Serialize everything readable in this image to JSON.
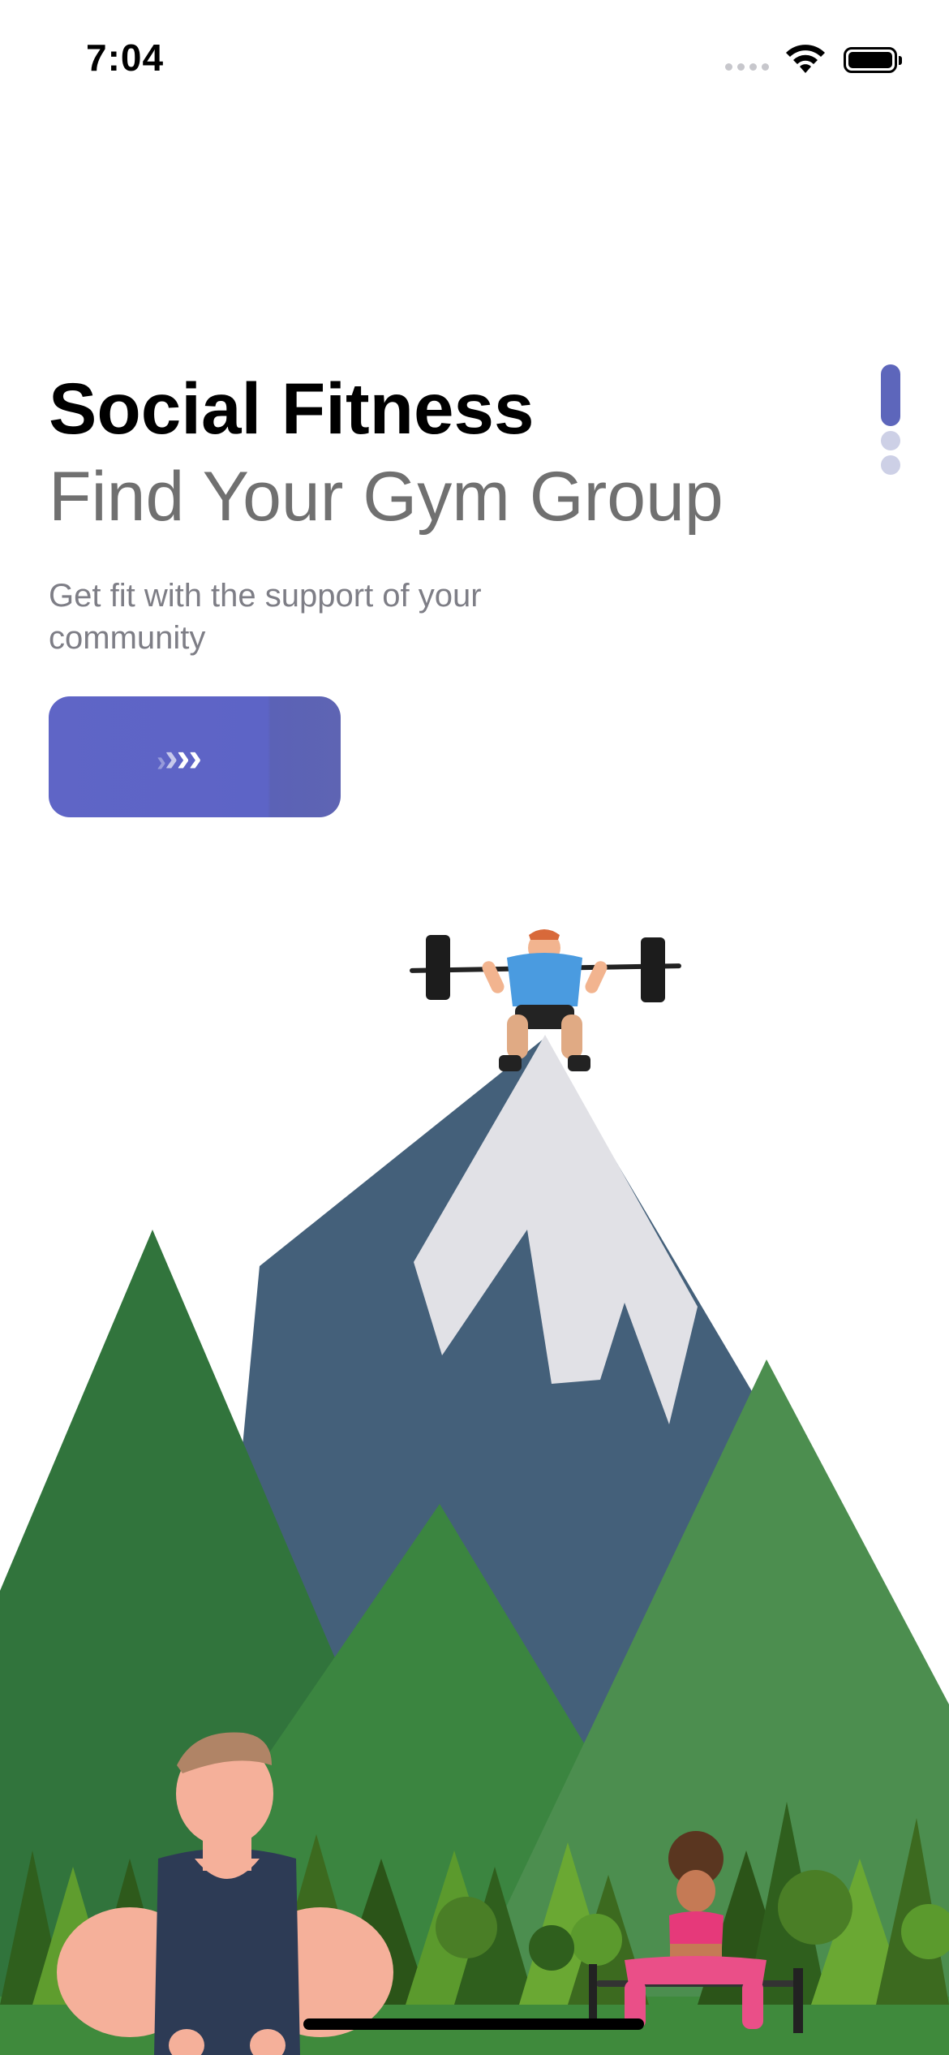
{
  "status_bar": {
    "time": "7:04",
    "icons": [
      "signal-icon",
      "wifi-icon",
      "battery-icon"
    ]
  },
  "onboarding": {
    "title": "Social Fitness",
    "subtitle": "Find Your Gym Group",
    "description": "Get fit with the support of your community",
    "next_button_icon": "chevrons-right-icon",
    "pager": {
      "total": 3,
      "active_index": 0
    }
  },
  "colors": {
    "accent": "#5d64c6",
    "pager_inactive": "#cdd0e6",
    "mountain_dark": "#44607a",
    "snow": "#e1e1e6",
    "forest_dark": "#31743c",
    "forest_mid": "#3b8540",
    "forest_light": "#4c8e4f"
  }
}
